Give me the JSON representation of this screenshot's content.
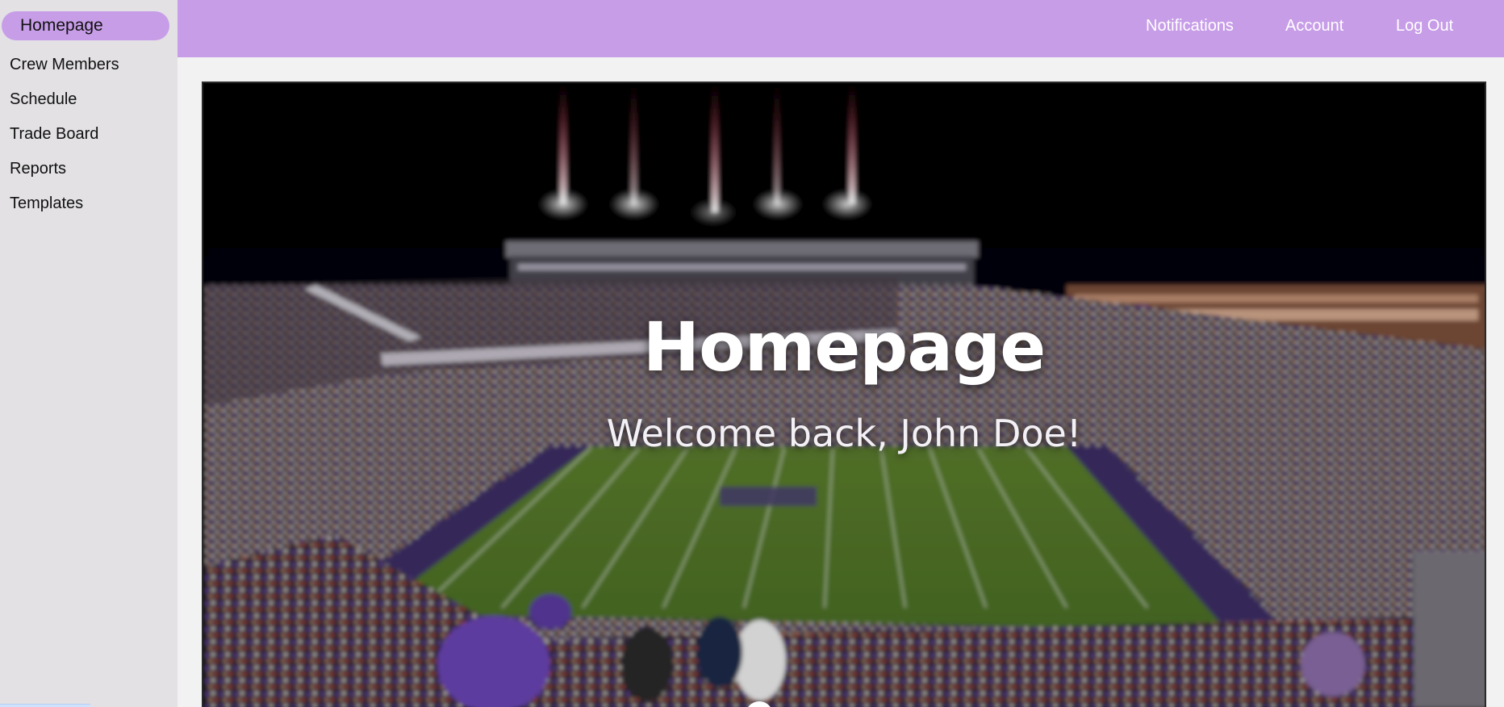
{
  "sidebar": {
    "items": [
      {
        "label": "Homepage",
        "active": true
      },
      {
        "label": "Crew Members",
        "active": false
      },
      {
        "label": "Schedule",
        "active": false
      },
      {
        "label": "Trade Board",
        "active": false
      },
      {
        "label": "Reports",
        "active": false
      },
      {
        "label": "Templates",
        "active": false
      }
    ]
  },
  "topbar": {
    "links": [
      {
        "label": "Notifications"
      },
      {
        "label": "Account"
      },
      {
        "label": "Log Out"
      }
    ]
  },
  "hero": {
    "title": "Homepage",
    "subtitle": "Welcome back, John Doe!",
    "image_icon": "stadium-photo"
  },
  "colors": {
    "accent": "#c79de8",
    "sidebar_bg": "#e3e1e4",
    "page_bg": "#f2f2f2",
    "text_dark": "#111111",
    "text_light": "#ffffff"
  }
}
